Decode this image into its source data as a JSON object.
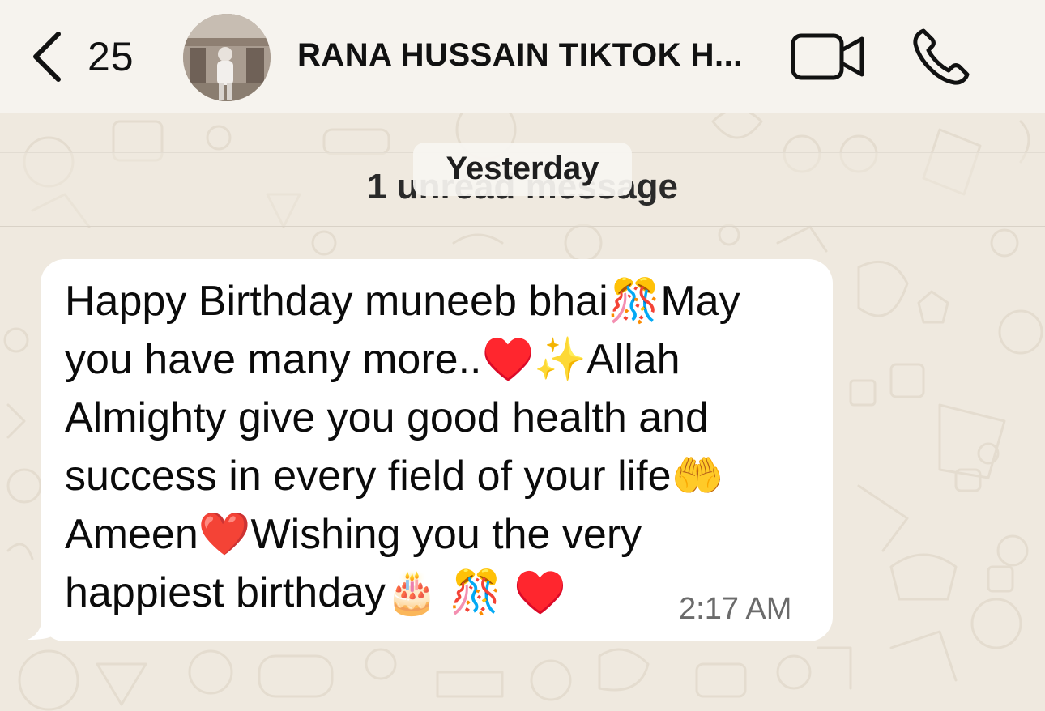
{
  "header": {
    "back_icon": "chevron-left-icon",
    "unread_count": "25",
    "contact_name": "RANA HUSSAIN TIKTOK H...",
    "video_icon": "video-camera-icon",
    "call_icon": "phone-icon"
  },
  "chat": {
    "unread_banner": "1 unread message",
    "date_label": "Yesterday",
    "message": {
      "text": "Happy Birthday muneeb bhai🎊May\nyou have many more..♥️✨Allah\nAlmighty give you good health and\nsuccess in every field of your life🤲\nAmeen❤️Wishing you the very\nhappiest birthday🎂 🎊 ♥️",
      "time": "2:17 AM"
    }
  },
  "colors": {
    "wallpaper": "#efe9df",
    "header_bg": "#f6f3ee",
    "bubble_bg": "#ffffff",
    "timestamp": "#6b6b6b"
  }
}
